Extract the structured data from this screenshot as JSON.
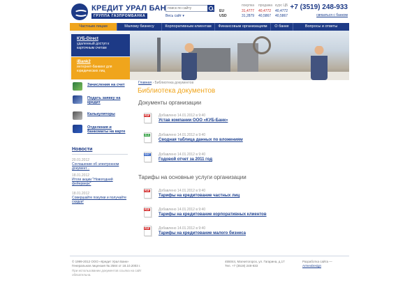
{
  "header": {
    "bank_name": "КРЕДИТ УРАЛ БАНК",
    "group_name": "ГРУППА ГАЗПРОМБАНКА",
    "search_placeholder": "поиск по сайту",
    "whole_site": "Весь сайт",
    "rates": {
      "headers": [
        "покупка",
        "продажа",
        "курс ЦБ"
      ],
      "rows": [
        {
          "currency": "EU",
          "buy": "31,4777",
          "sell": "40,4772",
          "cb": "40,4772",
          "buy_dir": "up",
          "sell_dir": "up"
        },
        {
          "currency": "USD",
          "buy": "31,2879",
          "sell": "40,5867",
          "cb": "40,5867",
          "buy_dir": "dn",
          "sell_dir": "dn"
        }
      ]
    },
    "phone": "+7 (3519) 248-933",
    "contact_link": "связаться с банком"
  },
  "nav": {
    "items": [
      {
        "label": "Частным лицам",
        "active": true
      },
      {
        "label": "Малому бизнесу",
        "active": false
      },
      {
        "label": "Корпоративным клиентам",
        "active": false
      },
      {
        "label": "Финансовым организациям",
        "active": false
      },
      {
        "label": "О банке",
        "active": false
      },
      {
        "label": "Вопросы и ответы",
        "active": false
      }
    ]
  },
  "promo": [
    {
      "title": "КУБ-Direct",
      "text": "удаленный доступ к карточным счетам"
    },
    {
      "title": "iBank2",
      "text": "интернет-банкинг для юридических лиц"
    }
  ],
  "sidebar": {
    "links": [
      {
        "label": "Зачисления на счет",
        "icon": "money-icon"
      },
      {
        "label": "Подать заявку на кредит",
        "icon": "card-icon"
      },
      {
        "label": "Калькуляторы",
        "icon": "calculator-icon"
      },
      {
        "label": "Отделения и банкоматы на карте",
        "icon": "atm-icon"
      }
    ],
    "news_title": "Новости",
    "news": [
      {
        "date": "20.01.2012",
        "text": "Соглашение об электронном документ..."
      },
      {
        "date": "18.01.2012",
        "text": "Итоги акции \"Новогодний фейерверк\""
      },
      {
        "date": "18.01.2012",
        "text": "Совершайте покупки и получайте скидки!"
      }
    ]
  },
  "content": {
    "breadcrumb_home": "Главная",
    "breadcrumb_current": "Библиотека документов",
    "title": "Библиотека документов",
    "sections": [
      {
        "title": "Документы организации",
        "docs": [
          {
            "type": "PDF",
            "color": "#d32f2f",
            "meta": "Добавлено 14.01.2012 в 9:40",
            "name": "Устав компании ООО «КУБ-Банк»"
          },
          {
            "type": "XLS",
            "color": "#2e9e3e",
            "meta": "Добавлено 14.01.2012 в 9:40",
            "name": "Сводная таблица данных по вложениям"
          },
          {
            "type": "DOC",
            "color": "#2f5fc2",
            "meta": "Добавлено 14.01.2012 в 9:40",
            "name": "Годовой отчет за 2011 год"
          }
        ]
      },
      {
        "title": "Тарифы на основные услуги организации",
        "docs": [
          {
            "type": "PDF",
            "color": "#d32f2f",
            "meta": "Добавлено 14.01.2012 в 9:40",
            "name": "Тарифы на кредитование частных лиц"
          },
          {
            "type": "PDF",
            "color": "#d32f2f",
            "meta": "Добавлено 14.01.2012 в 9:40",
            "name": "Тарифы на кредитование корпоративных клиентов"
          },
          {
            "type": "PDF",
            "color": "#d32f2f",
            "meta": "Добавлено 14.01.2012 в 9:40",
            "name": "Тарифы на кредитование малого бизнеса"
          }
        ]
      }
    ]
  },
  "footer": {
    "copyright": "© 1999-2012 ООО «Кредит Урал Банк»",
    "license": "Генеральная лицензия № 2584 от 18.10.2003 г.",
    "note": "При использовании документов ссылка на сайт обязательна.",
    "address": "455044, Магнитогорск, ул. Гагарина, д.17",
    "tel": "Тел. +7 (3519) 248-933",
    "dev_label": "Разработка сайта —",
    "dev_link": "ArmexDesign"
  }
}
